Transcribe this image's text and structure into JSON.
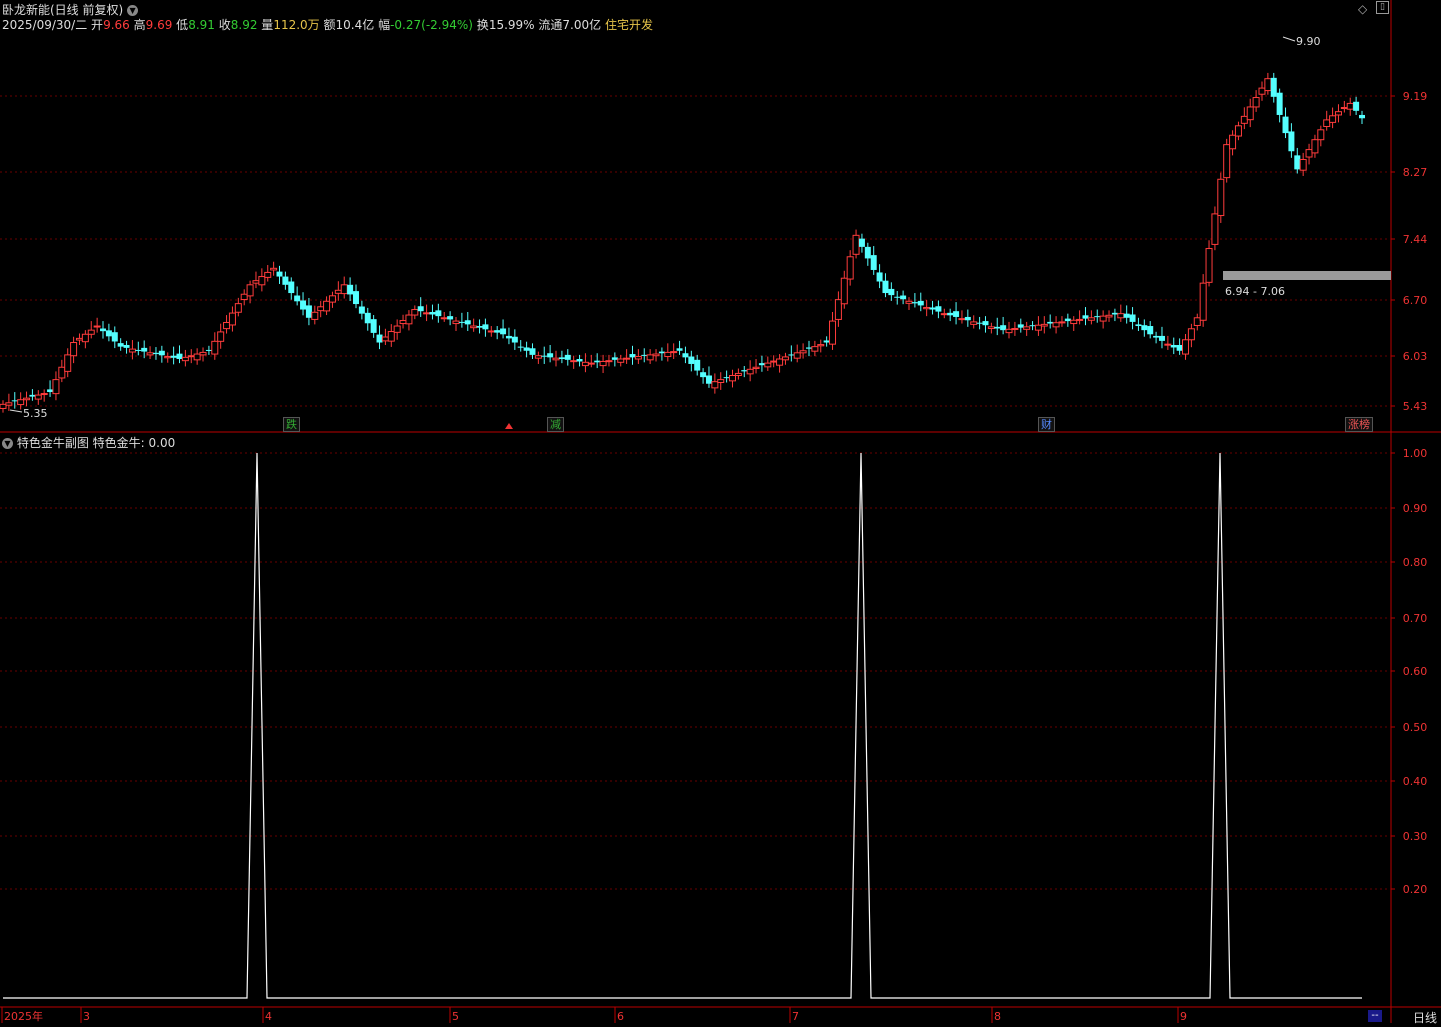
{
  "header": {
    "stock_title": "卧龙新能(日线 前复权)",
    "date": "2025/09/30/二",
    "open_label": "开",
    "open": "9.66",
    "high_label": "高",
    "high": "9.69",
    "low_label": "低",
    "low": "8.91",
    "close_label": "收",
    "close": "8.92",
    "volume_label": "量",
    "volume": "112.0万",
    "amount_label": "额",
    "amount": "10.4亿",
    "change_label": "幅",
    "change": "-0.27(-2.94%)",
    "turnover_label": "换",
    "turnover": "15.99%",
    "float_label": "流通",
    "float_value": "7.00亿",
    "sector": "住宅开发"
  },
  "main_chart": {
    "y_ticks": [
      "9.19",
      "8.27",
      "7.44",
      "6.70",
      "6.03",
      "5.43"
    ],
    "high_marker": "9.90",
    "low_marker": "5.35",
    "zone_label": "6.94 - 7.06",
    "event_marks": [
      {
        "label": "跌",
        "color": "#3a3"
      },
      {
        "label": "减",
        "color": "#3a3"
      },
      {
        "label": "财",
        "color": "#58f"
      },
      {
        "label": "涨榜",
        "color": "#e55"
      }
    ]
  },
  "indicator": {
    "title": "特色金牛副图",
    "value_label": "特色金牛:",
    "value": "0.00",
    "y_ticks": [
      "1.00",
      "0.90",
      "0.80",
      "0.70",
      "0.60",
      "0.50",
      "0.40",
      "0.30",
      "0.20"
    ],
    "spike_values": [
      0,
      1,
      0,
      1,
      0,
      1,
      0
    ]
  },
  "x_axis": {
    "labels": [
      "2025年",
      "3",
      "4",
      "5",
      "6",
      "7",
      "8",
      "9"
    ],
    "period": "日线",
    "scroll": "--"
  },
  "icons": [
    "diamond-icon",
    "window-icon",
    "dropdown-icon"
  ],
  "colors": {
    "up": "#ff3c3c",
    "down": "#54ffff",
    "grid": "#8b0000",
    "indicator_line": "#ffffff",
    "zone_bar": "#9a9a9a"
  },
  "chart_data": {
    "type": "candlestick",
    "title": "卧龙新能(日线 前复权)",
    "ylim": [
      5.35,
      9.9
    ],
    "series": [
      {
        "name": "日线",
        "ohlc_sample": [
          {
            "x": "2025/02",
            "o": 5.5,
            "h": 5.6,
            "l": 5.35,
            "c": 5.45
          },
          {
            "x": "2025/03",
            "o": 6.1,
            "h": 6.3,
            "l": 5.9,
            "c": 6.2
          },
          {
            "x": "2025/04",
            "o": 6.9,
            "h": 7.4,
            "l": 6.2,
            "c": 6.7
          },
          {
            "x": "2025/05",
            "o": 6.3,
            "h": 6.6,
            "l": 6.2,
            "c": 6.25
          },
          {
            "x": "2025/06",
            "o": 6.0,
            "h": 6.2,
            "l": 5.9,
            "c": 6.05
          },
          {
            "x": "2025/07",
            "o": 7.3,
            "h": 7.6,
            "l": 6.9,
            "c": 7.0
          },
          {
            "x": "2025/08",
            "o": 6.3,
            "h": 6.5,
            "l": 6.1,
            "c": 6.2
          },
          {
            "x": "2025/09",
            "o": 9.66,
            "h": 9.69,
            "l": 8.91,
            "c": 8.92
          }
        ]
      },
      {
        "name": "特色金牛",
        "values": [
          0,
          1,
          0,
          1,
          0,
          1,
          0
        ]
      }
    ]
  }
}
